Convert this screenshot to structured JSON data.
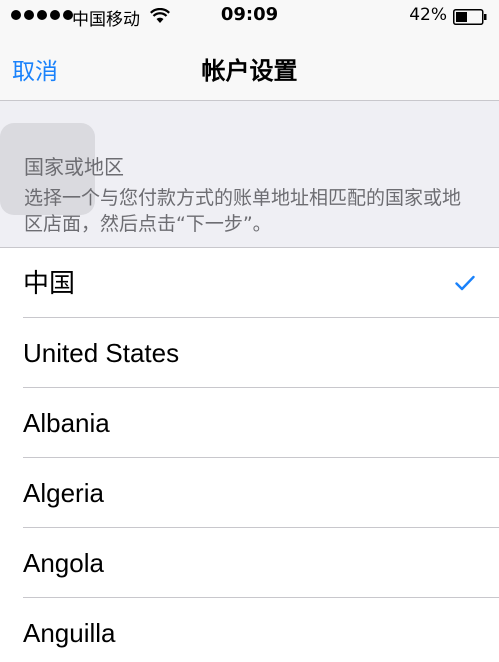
{
  "status_bar": {
    "carrier": "中国移动",
    "time": "09:09",
    "battery": "42%"
  },
  "nav": {
    "cancel_label": "取消",
    "title": "帐户设置"
  },
  "section": {
    "title": "国家或地区",
    "description": "选择一个与您付款方式的账单地址相匹配的国家或地区店面，然后点击“下一步”。"
  },
  "countries": [
    {
      "label": "中国",
      "selected": true
    },
    {
      "label": "United States",
      "selected": false
    },
    {
      "label": "Albania",
      "selected": false
    },
    {
      "label": "Algeria",
      "selected": false
    },
    {
      "label": "Angola",
      "selected": false
    },
    {
      "label": "Anguilla",
      "selected": false
    }
  ],
  "colors": {
    "accent": "#1a82fb",
    "section_text": "#6d6d72",
    "separator": "#c8c7cc"
  },
  "icons": {
    "wifi": "wifi-icon",
    "battery": "battery-icon",
    "check": "checkmark-icon"
  }
}
